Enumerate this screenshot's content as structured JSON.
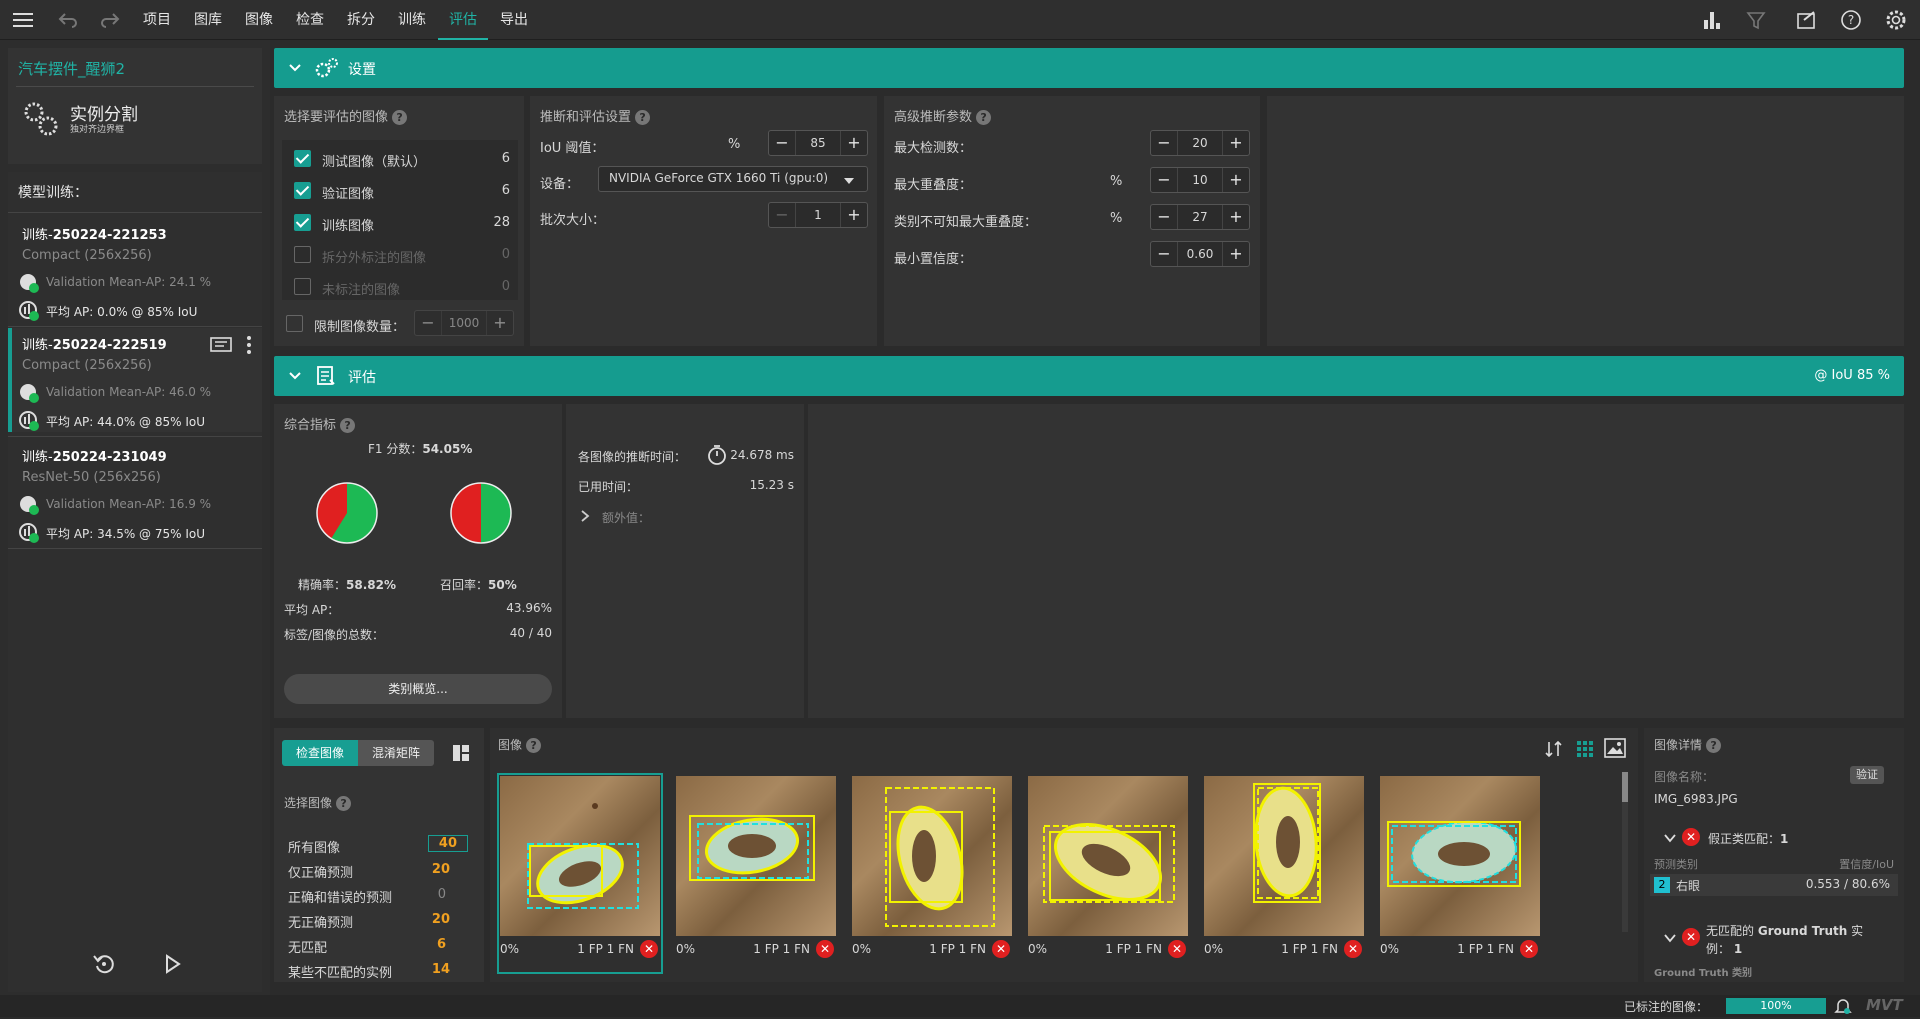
{
  "menu": {
    "items": [
      "项目",
      "图库",
      "图像",
      "检查",
      "拆分",
      "训练",
      "评估",
      "导出"
    ],
    "active": "评估"
  },
  "sidebar": {
    "project_name": "汽车摆件_醒狮2",
    "task_title": "实例分割",
    "task_subtitle": "独对齐边界框",
    "training_heading": "模型训练：",
    "models": [
      {
        "title_prefix": "训练-",
        "title_id": "250224-221253",
        "arch": "Compact (256x256)",
        "val": "Validation Mean-AP: 24.1 %",
        "ap": "平均 AP: 0.0% @ 85% IoU"
      },
      {
        "title_prefix": "训练-",
        "title_id": "250224-222519",
        "arch": "Compact (256x256)",
        "val": "Validation Mean-AP: 46.0 %",
        "ap": "平均 AP: 44.0% @ 85% IoU"
      },
      {
        "title_prefix": "训练-",
        "title_id": "250224-231049",
        "arch": "ResNet-50 (256x256)",
        "val": "Validation Mean-AP: 16.9 %",
        "ap": "平均 AP: 34.5% @ 75% IoU"
      }
    ]
  },
  "settings_bar": {
    "title": "设置"
  },
  "select_images": {
    "heading": "选择要评估的图像",
    "rows": [
      {
        "label": "测试图像（默认）",
        "count": "6",
        "checked": true
      },
      {
        "label": "验证图像",
        "count": "6",
        "checked": true
      },
      {
        "label": "训练图像",
        "count": "28",
        "checked": true
      },
      {
        "label": "拆分外标注的图像",
        "count": "0",
        "checked": false
      },
      {
        "label": "未标注的图像",
        "count": "0",
        "checked": false
      }
    ],
    "limit_label": "限制图像数量：",
    "limit_value": "1000"
  },
  "inference": {
    "heading": "推断和评估设置",
    "iou_label": "IoU 阈值：",
    "iou_unit": "%",
    "iou_value": "85",
    "device_label": "设备：",
    "device_value": "NVIDIA GeForce GTX 1660 Ti (gpu:0)",
    "batch_label": "批次大小：",
    "batch_value": "1"
  },
  "advanced": {
    "heading": "高级推断参数",
    "rows": [
      {
        "label": "最大检测数：",
        "unit": "",
        "value": "20"
      },
      {
        "label": "最大重叠度：",
        "unit": "%",
        "value": "10"
      },
      {
        "label": "类别不可知最大重叠度：",
        "unit": "%",
        "value": "27"
      },
      {
        "label": "最小置信度：",
        "unit": "",
        "value": "0.60"
      }
    ]
  },
  "eval_bar": {
    "title": "评估",
    "iou": "@ IoU 85 %"
  },
  "metrics": {
    "heading": "综合指标",
    "f1_label": "F1 分数：",
    "f1_value": "54.05%",
    "precision_label": "精确率：",
    "precision_value": "58.82%",
    "recall_label": "召回率：",
    "recall_value": "50%",
    "precision_frac": 0.5882,
    "recall_frac": 0.5,
    "ap_label": "平均 AP：",
    "ap_value": "43.96%",
    "total_label": "标签/图像的总数：",
    "total_value": "40 / 40",
    "class_button": "类别概览..."
  },
  "timing": {
    "per_image_label": "各图像的推断时间：",
    "per_image_value": "24.678 ms",
    "elapsed_label": "已用时间：",
    "elapsed_value": "15.23 s",
    "extra_label": "额外值："
  },
  "browser": {
    "tab_inspect": "检查图像",
    "tab_confusion": "混淆矩阵",
    "select_heading": "选择图像",
    "filters": [
      {
        "label": "所有图像",
        "count": "40"
      },
      {
        "label": "仅正确预测",
        "count": "20"
      },
      {
        "label": "正确和错误的预测",
        "count": "0"
      },
      {
        "label": "无正确预测",
        "count": "20"
      },
      {
        "label": "无匹配",
        "count": "6"
      },
      {
        "label": "某些不匹配的实例",
        "count": "14"
      }
    ]
  },
  "images": {
    "heading": "图像",
    "thumbs": [
      {
        "pct": "0%",
        "stats": "1 FP 1 FN"
      },
      {
        "pct": "0%",
        "stats": "1 FP 1 FN"
      },
      {
        "pct": "0%",
        "stats": "1 FP 1 FN"
      },
      {
        "pct": "0%",
        "stats": "1 FP 1 FN"
      },
      {
        "pct": "0%",
        "stats": "1 FP 1 FN"
      },
      {
        "pct": "0%",
        "stats": "1 FP 1 FN"
      }
    ]
  },
  "details": {
    "heading": "图像详情",
    "name_label": "图像名称：",
    "split_badge": "验证",
    "name_value": "IMG_6983.JPG",
    "fp_label": "假正类匹配：",
    "fp_count": "1",
    "pred_class_header": "预测类别",
    "conf_header": "置信度/IoU",
    "pred_class_id": "2",
    "pred_class_name": "右眼",
    "pred_conf": "0.553",
    "pred_sep": "/",
    "pred_iou": "80.6%",
    "gt_label_a": "无匹配的",
    "gt_label_b": "Ground Truth",
    "gt_label_c": "实",
    "gt_label_d": "例：",
    "gt_count": "1",
    "gt_class_header": "Ground Truth 类别"
  },
  "status": {
    "labeled_label": "已标注的图像：",
    "labeled_value": "100%",
    "labeled_frac": 1.0,
    "brand": "MVT"
  },
  "colors": {
    "accent": "#159c8f",
    "danger": "#e02020",
    "ok": "#1db954",
    "warn": "#f0a020"
  }
}
